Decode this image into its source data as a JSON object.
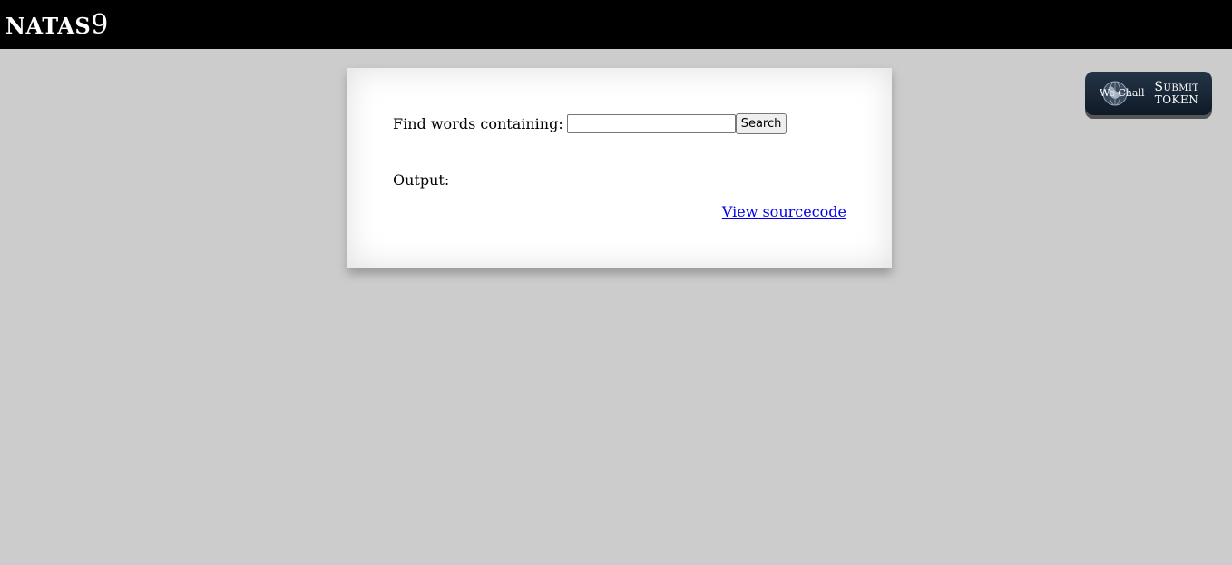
{
  "header": {
    "title": "NATAS",
    "level": "9"
  },
  "form": {
    "label": "Find words containing:",
    "input_value": "",
    "input_placeholder": "",
    "button_label": "Search"
  },
  "output": {
    "label": "Output:"
  },
  "links": {
    "view_source": "View sourcecode"
  },
  "wechall_button": {
    "brand": "We Chall",
    "line1": "Submit",
    "line2": "TOKEN"
  },
  "colors": {
    "background": "#cccccc",
    "header": "#000000",
    "panel": "#ffffff",
    "link": "#0000ee",
    "wechall": "#1a2636"
  }
}
